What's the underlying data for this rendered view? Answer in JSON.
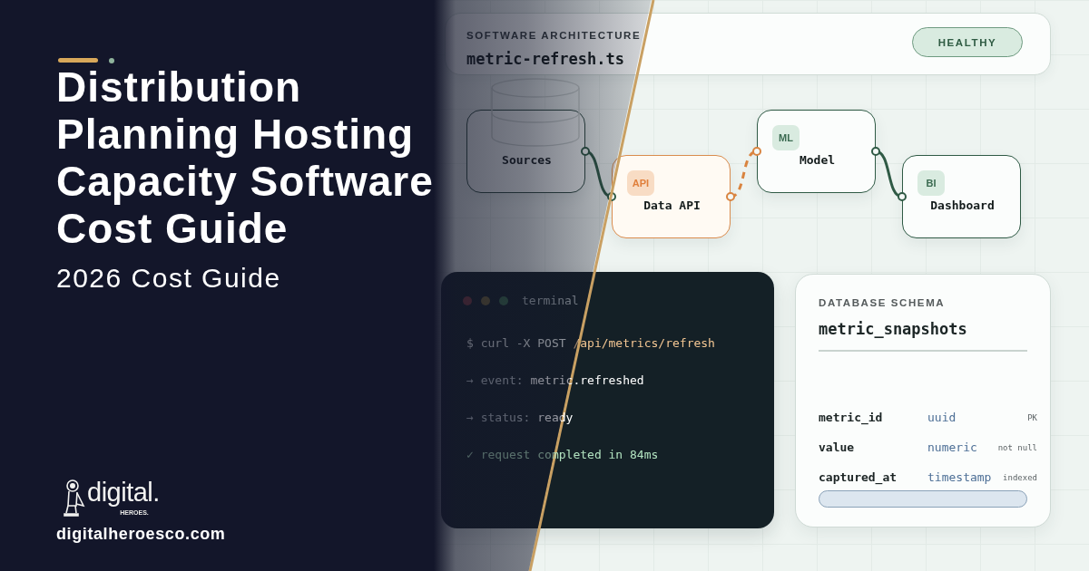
{
  "hero": {
    "title": "Distribution Planning Hosting Capacity Software Cost Guide",
    "subtitle": "2026 Cost Guide"
  },
  "brand": {
    "wordmark": "digital.",
    "tagline": "HEROES.",
    "website": "digitalheroesco.com"
  },
  "header_card": {
    "eyebrow": "SOFTWARE ARCHITECTURE",
    "filename": "metric-refresh.ts",
    "status": "HEALTHY"
  },
  "diagram": {
    "nodes": [
      {
        "kind": "source",
        "label": "Sources"
      },
      {
        "kind": "accent",
        "badge": "API",
        "label": "Data API"
      },
      {
        "kind": "default",
        "badge": "ML",
        "label": "Model"
      },
      {
        "kind": "default",
        "badge": "BI",
        "label": "Dashboard"
      }
    ],
    "links": [
      {
        "kind": "solid"
      },
      {
        "kind": "dashed"
      },
      {
        "kind": "solid"
      }
    ]
  },
  "terminal": {
    "title": "terminal",
    "lines": [
      {
        "kind": "command",
        "prefix": "$ curl -X POST",
        "text": "/api/metrics/refresh"
      },
      {
        "kind": "output",
        "prefix": "→ event:",
        "text": "metric.refreshed"
      },
      {
        "kind": "output",
        "prefix": "→ status:",
        "text": "ready"
      },
      {
        "kind": "success",
        "text": "✓ request completed in 84ms"
      }
    ]
  },
  "schema": {
    "eyebrow": "DATABASE SCHEMA",
    "table": "metric_snapshots",
    "rows": [
      {
        "name": "metric_id",
        "type": "uuid",
        "tag": "PK"
      },
      {
        "name": "value",
        "type": "numeric",
        "tag": "not null"
      },
      {
        "name": "captured_at",
        "type": "timestamp",
        "tag": "indexed"
      }
    ]
  }
}
